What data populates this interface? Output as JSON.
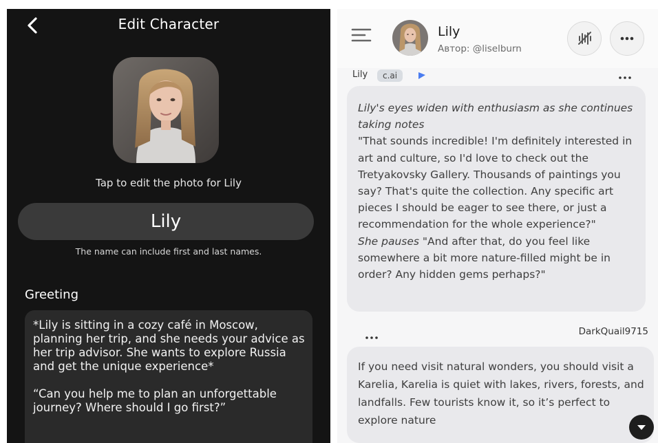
{
  "edit_screen": {
    "title": "Edit Character",
    "photo_hint": "Tap to edit the photo for Lily",
    "name_value": "Lily",
    "name_hint": "The name can include first and last names.",
    "greeting_label": "Greeting",
    "greeting_text": "*Lily is sitting in a cozy café in Moscow, planning her trip, and she needs your advice as her trip advisor. She wants to explore Russia and get the unique experience*\n\n“Can you help me to plan an unforgettable journey? Where should I go first?”"
  },
  "chat_screen": {
    "character_name": "Lily",
    "author": "Автор: @liselburn",
    "message1": {
      "sender": "Lily",
      "badge": "c.ai",
      "action1": "Lily's eyes widen with enthusiasm as she continues taking notes",
      "speech1": "\"That sounds incredible! I'm definitely interested in art and culture, so I'd love to check out the Tretyakovsky Gallery. Thousands of paintings you say? That's quite the collection. Any specific art pieces I should be eager to see there, or just a recommendation for the whole experience?\"",
      "action2": "She pauses",
      "speech2": " \"And after that, do you feel like somewhere a bit more nature-filled might be in order? Any hidden gems perhaps?\""
    },
    "message2": {
      "sender": "DarkQuail9715",
      "text": "If you need visit natural wonders, you should visit a Karelia,  Karelia is quiet with lakes, rivers, forests, and landfalls. Few tourists know it, so it’s perfect to explore nature"
    }
  },
  "colors": {
    "dark_bg": "#141414",
    "name_field_bg": "#3a3a3a",
    "bubble_bg": "#e9e9ec",
    "badge_flag": "#4a7cf0"
  },
  "icons": {
    "back": "chevron-left-icon",
    "menu": "hamburger-menu-icon",
    "voice": "voice-muted-icon",
    "more": "more-horizontal-icon",
    "scroll": "chevron-down-icon"
  }
}
